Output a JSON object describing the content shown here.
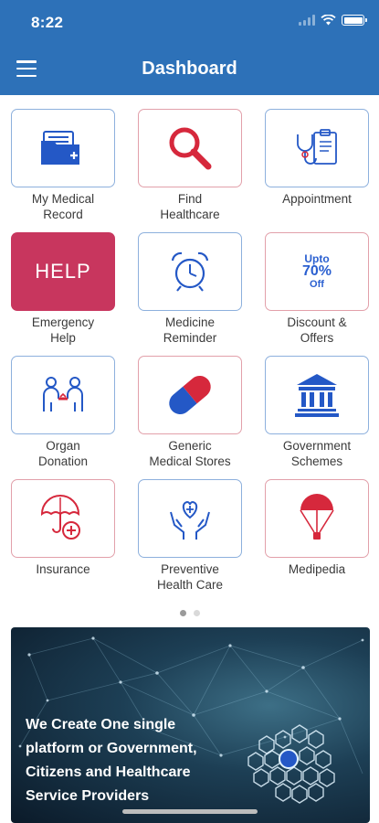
{
  "status_bar": {
    "time": "8:22"
  },
  "header": {
    "title": "Dashboard"
  },
  "tiles": [
    {
      "label": "My Medical\nRecord"
    },
    {
      "label": "Find\nHealthcare"
    },
    {
      "label": "Appointment"
    },
    {
      "label": "Emergency\nHelp",
      "badge": "HELP"
    },
    {
      "label": "Medicine\nReminder"
    },
    {
      "label": "Discount &\nOffers",
      "badge_top": "Upto",
      "badge_mid": "70%",
      "badge_bot": "Off"
    },
    {
      "label": "Organ\nDonation"
    },
    {
      "label": "Generic\nMedical Stores"
    },
    {
      "label": "Government\nSchemes"
    },
    {
      "label": "Insurance"
    },
    {
      "label": "Preventive\nHealth Care"
    },
    {
      "label": "Medipedia"
    }
  ],
  "pager": {
    "count": 2,
    "active": 1
  },
  "banner": {
    "text": "We Create One single\nplatform or Government,\nCitizens and Healthcare\nService Providers"
  },
  "colors": {
    "header": "#2d71b8",
    "icon_blue": "#2458c6",
    "icon_red": "#d6283c",
    "help_tile": "#c8365e"
  }
}
